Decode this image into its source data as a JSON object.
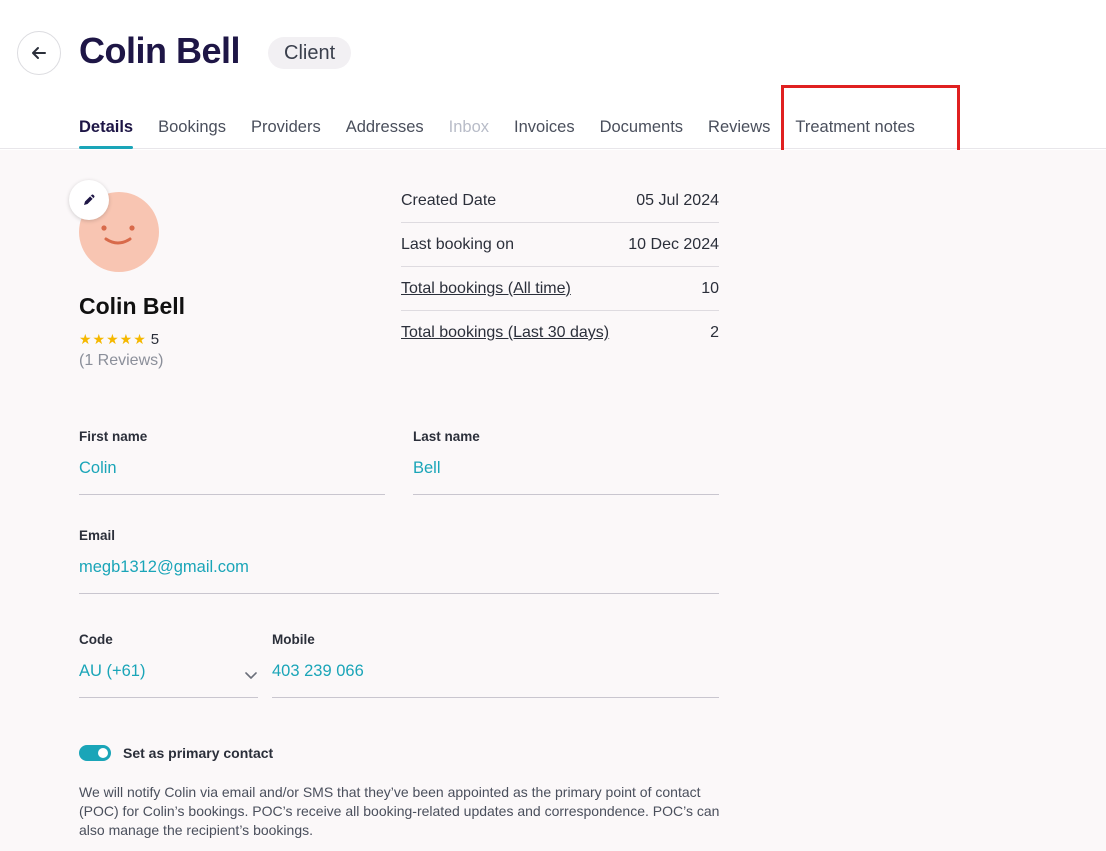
{
  "header": {
    "title": "Colin Bell",
    "role_badge": "Client",
    "back_icon": "arrow-left-icon"
  },
  "tabs": [
    {
      "label": "Details",
      "state": "active"
    },
    {
      "label": "Bookings",
      "state": "normal"
    },
    {
      "label": "Providers",
      "state": "normal"
    },
    {
      "label": "Addresses",
      "state": "normal"
    },
    {
      "label": "Inbox",
      "state": "disabled"
    },
    {
      "label": "Invoices",
      "state": "normal"
    },
    {
      "label": "Documents",
      "state": "normal"
    },
    {
      "label": "Reviews",
      "state": "normal"
    },
    {
      "label": "Treatment notes",
      "state": "highlighted"
    }
  ],
  "profile": {
    "name": "Colin Bell",
    "stars": "★★★★★",
    "rating": "5",
    "reviews": "(1 Reviews)",
    "edit_icon": "pencil-icon",
    "avatar_icon": "smiley-face-icon"
  },
  "stats": [
    {
      "label": "Created Date",
      "value": "05 Jul 2024",
      "link": false
    },
    {
      "label": "Last booking on",
      "value": "10 Dec 2024",
      "link": false
    },
    {
      "label": "Total bookings (All time)",
      "value": "10",
      "link": true
    },
    {
      "label": "Total bookings (Last 30 days)",
      "value": "2",
      "link": true
    }
  ],
  "form": {
    "first_name": {
      "label": "First name",
      "value": "Colin"
    },
    "last_name": {
      "label": "Last name",
      "value": "Bell"
    },
    "email": {
      "label": "Email",
      "value": "megb1312@gmail.com"
    },
    "code": {
      "label": "Code",
      "value": "AU (+61)"
    },
    "mobile": {
      "label": "Mobile",
      "value": "403 239 066"
    }
  },
  "primary_contact": {
    "label": "Set as primary contact",
    "enabled": true,
    "note": "We will notify Colin via email and/or SMS that they’ve been appointed as the primary point of contact (POC) for Colin’s bookings. POC’s receive all booking-related updates and correspondence. POC’s can also manage the recipient’s bookings."
  },
  "colors": {
    "accent": "#1aa5b8",
    "title": "#1e1646",
    "highlight": "#e02020",
    "star": "#f5b800"
  }
}
